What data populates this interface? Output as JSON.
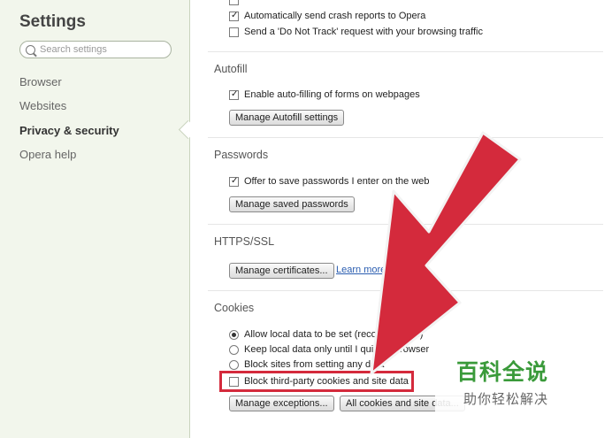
{
  "sidebar": {
    "title": "Settings",
    "search_placeholder": "Search settings",
    "items": [
      {
        "label": "Browser"
      },
      {
        "label": "Websites"
      },
      {
        "label": "Privacy & security"
      },
      {
        "label": "Opera help"
      }
    ]
  },
  "privacy": {
    "crash_reports": "Automatically send crash reports to Opera",
    "do_not_track": "Send a 'Do Not Track' request with your browsing traffic"
  },
  "autofill": {
    "heading": "Autofill",
    "enable": "Enable auto-filling of forms on webpages",
    "manage_button": "Manage Autofill settings"
  },
  "passwords": {
    "heading": "Passwords",
    "offer": "Offer to save passwords I enter on the web",
    "manage_button": "Manage saved passwords"
  },
  "https": {
    "heading": "HTTPS/SSL",
    "manage_button": "Manage certificates...",
    "learn_more": "Learn more"
  },
  "cookies": {
    "heading": "Cookies",
    "allow": "Allow local data to be set (recommended)",
    "keep_until_quit": "Keep local data only until I quit my browser",
    "block_sites": "Block sites from setting any data",
    "block_third_party": "Block third-party cookies and site data",
    "exceptions_button": "Manage exceptions...",
    "all_cookies_button": "All cookies and site data..."
  },
  "watermark": {
    "title": "百科全说",
    "subtitle": "助你轻松解决"
  },
  "colors": {
    "arrow": "#d42a3c",
    "sidebar_bg": "#f2f6ec",
    "watermark_green": "#3a9a3a"
  }
}
